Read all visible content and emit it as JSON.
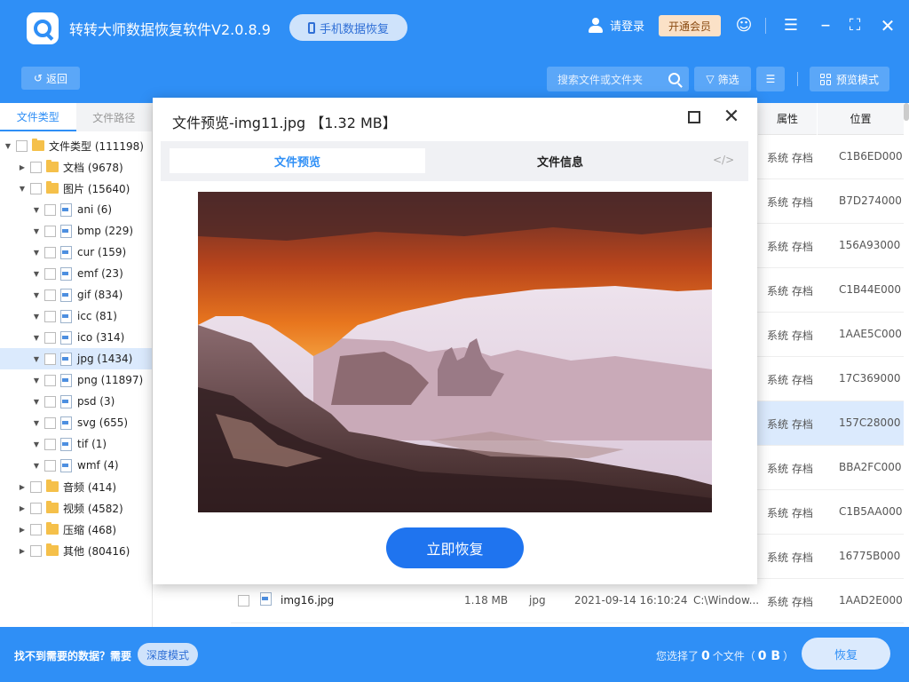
{
  "app": {
    "title": "转转大师数据恢复软件V2.0.8.9",
    "phone_btn": "手机数据恢复",
    "login": "请登录",
    "vip": "开通会员"
  },
  "toolbar": {
    "back": "返回",
    "search_placeholder": "搜索文件或文件夹",
    "filter": "筛选",
    "preview_mode": "预览模式"
  },
  "sidebar": {
    "tabs": [
      {
        "label": "文件类型"
      },
      {
        "label": "文件路径"
      }
    ],
    "tree": [
      {
        "label": "文件类型 (111198)",
        "level": 0,
        "kind": "folder",
        "arrow": "▼"
      },
      {
        "label": "文档 (9678)",
        "level": 1,
        "kind": "folder",
        "arrow": "▶"
      },
      {
        "label": "图片 (15640)",
        "level": 1,
        "kind": "folder",
        "arrow": "▼"
      },
      {
        "label": "ani (6)",
        "level": 2,
        "kind": "file",
        "arrow": "▼"
      },
      {
        "label": "bmp (229)",
        "level": 2,
        "kind": "file",
        "arrow": "▼"
      },
      {
        "label": "cur (159)",
        "level": 2,
        "kind": "file",
        "arrow": "▼"
      },
      {
        "label": "emf (23)",
        "level": 2,
        "kind": "file",
        "arrow": "▼"
      },
      {
        "label": "gif (834)",
        "level": 2,
        "kind": "file",
        "arrow": "▼"
      },
      {
        "label": "icc (81)",
        "level": 2,
        "kind": "file",
        "arrow": "▼"
      },
      {
        "label": "ico (314)",
        "level": 2,
        "kind": "file",
        "arrow": "▼"
      },
      {
        "label": "jpg (1434)",
        "level": 2,
        "kind": "file",
        "arrow": "▼",
        "selected": true
      },
      {
        "label": "png (11897)",
        "level": 2,
        "kind": "file",
        "arrow": "▼"
      },
      {
        "label": "psd (3)",
        "level": 2,
        "kind": "file",
        "arrow": "▼"
      },
      {
        "label": "svg (655)",
        "level": 2,
        "kind": "file",
        "arrow": "▼"
      },
      {
        "label": "tif (1)",
        "level": 2,
        "kind": "file",
        "arrow": "▼"
      },
      {
        "label": "wmf (4)",
        "level": 2,
        "kind": "file",
        "arrow": "▼"
      },
      {
        "label": "音频 (414)",
        "level": 1,
        "kind": "folder",
        "arrow": "▶"
      },
      {
        "label": "视频 (4582)",
        "level": 1,
        "kind": "folder",
        "arrow": "▶"
      },
      {
        "label": "压缩 (468)",
        "level": 1,
        "kind": "folder",
        "arrow": "▶"
      },
      {
        "label": "其他 (80416)",
        "level": 1,
        "kind": "folder",
        "arrow": "▶"
      }
    ]
  },
  "list": {
    "headers": {
      "attr": "属性",
      "location": "位置"
    },
    "rows": [
      {
        "attr": "系统 存档",
        "loc": "C1B6ED000"
      },
      {
        "attr": "系统 存档",
        "loc": "B7D274000"
      },
      {
        "attr": "系统 存档",
        "loc": "156A93000"
      },
      {
        "attr": "系统 存档",
        "loc": "C1B44E000"
      },
      {
        "attr": "系统 存档",
        "loc": "1AAE5C000"
      },
      {
        "attr": "系统 存档",
        "loc": "17C369000"
      },
      {
        "attr": "系统 存档",
        "loc": "157C28000",
        "selected": true
      },
      {
        "attr": "系统 存档",
        "loc": "BBA2FC000"
      },
      {
        "attr": "系统 存档",
        "loc": "C1B5AA000"
      },
      {
        "attr": "系统 存档",
        "loc": "16775B000"
      }
    ],
    "last_row": {
      "name": "img16.jpg",
      "size": "1.18 MB",
      "type": "jpg",
      "date": "2021-09-14 16:10:24",
      "path": "C:\\Window...",
      "attr": "系统 存档",
      "loc": "1AAD2E000"
    }
  },
  "modal": {
    "title": "文件预览-img11.jpg 【1.32 MB】",
    "tab_preview": "文件预览",
    "tab_info": "文件信息",
    "code_icon": "</>",
    "restore": "立即恢复"
  },
  "footer": {
    "question": "找不到需要的数据？需要",
    "deep_mode": "深度模式",
    "selected_prefix": "您选择了",
    "selected_count": "0",
    "selected_mid": "个文件（",
    "selected_size": "0 B",
    "selected_suffix": "）",
    "recover": "恢复"
  },
  "colors": {
    "primary": "#2f8ff6",
    "button": "#1f74ef",
    "selected_row": "#dbeafd"
  }
}
